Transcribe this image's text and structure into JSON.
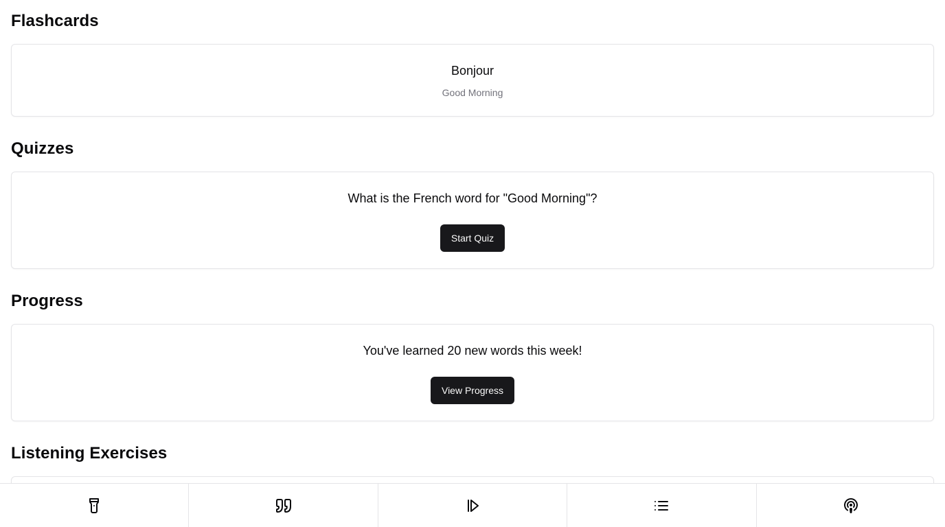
{
  "sections": {
    "flashcards": {
      "title": "Flashcards",
      "word": "Bonjour",
      "translation": "Good Morning"
    },
    "quizzes": {
      "title": "Quizzes",
      "question": "What is the French word for \"Good Morning\"?",
      "button_label": "Start Quiz"
    },
    "progress": {
      "title": "Progress",
      "message": "You've learned 20 new words this week!",
      "button_label": "View Progress"
    },
    "listening": {
      "title": "Listening Exercises"
    }
  },
  "bottom_nav": {
    "items": [
      {
        "icon": "flashlight-icon"
      },
      {
        "icon": "quote-icon"
      },
      {
        "icon": "play-icon"
      },
      {
        "icon": "list-icon"
      },
      {
        "icon": "podcast-icon"
      }
    ]
  },
  "colors": {
    "button_bg": "#18181b",
    "button_text": "#fafafa",
    "muted_text": "#71717a",
    "border": "#e4e4e7"
  }
}
